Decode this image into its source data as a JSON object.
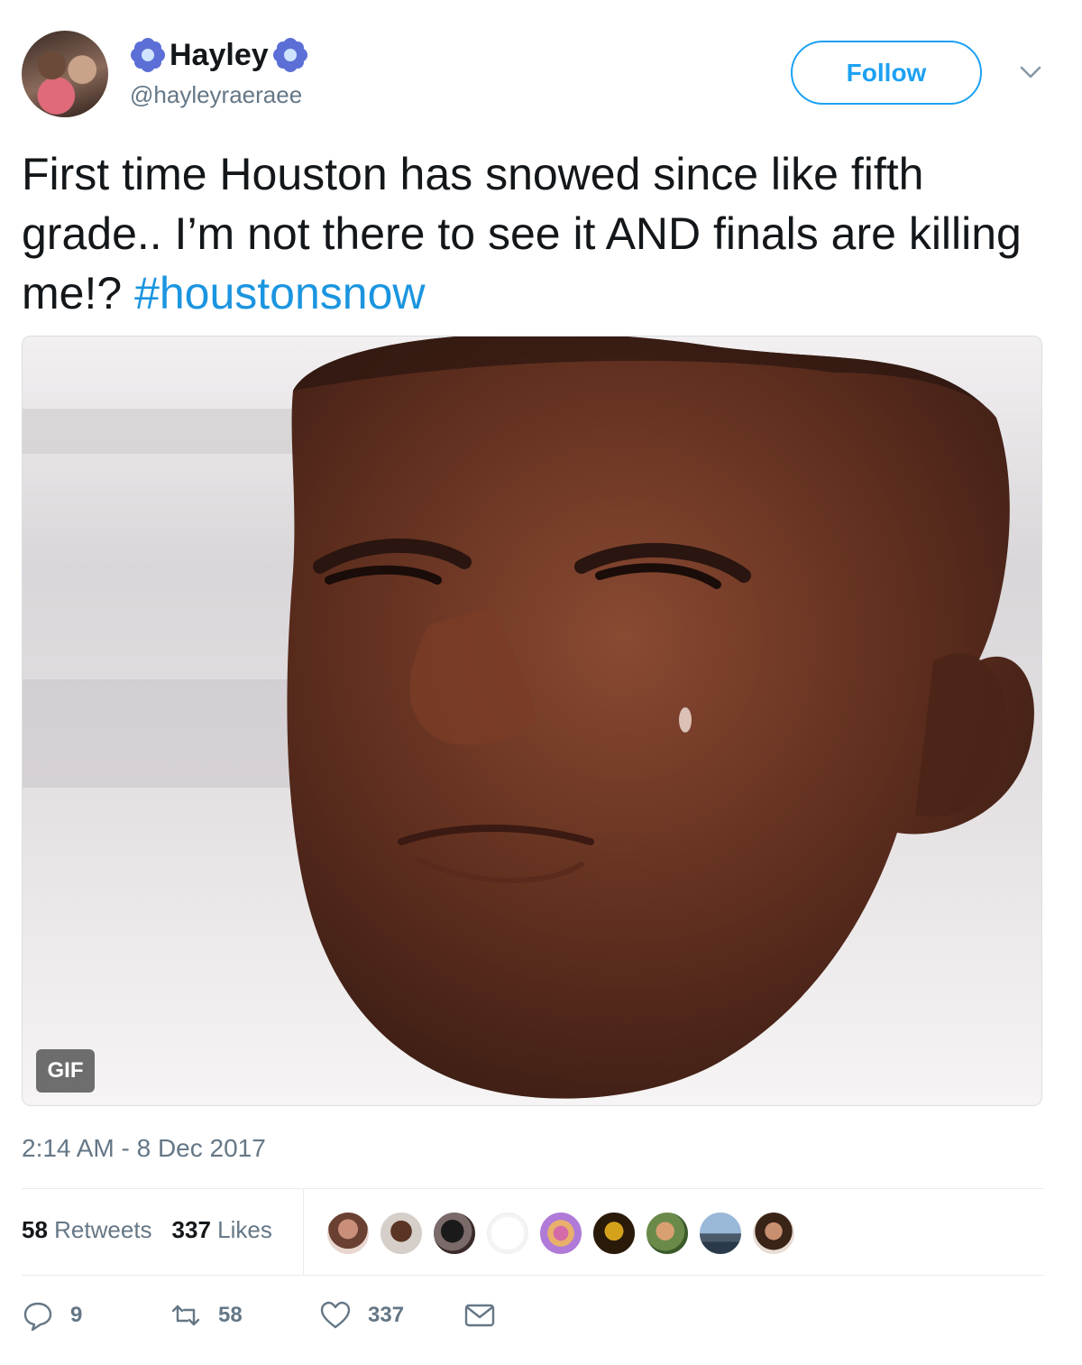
{
  "tweet": {
    "display_name": "Hayley",
    "handle": "@hayleyraeraee",
    "follow_label": "Follow",
    "text": "First time Houston has snowed since like fifth grade.. I’m not there to see it AND finals are killing me!? ",
    "hashtag": "#houstonsnow",
    "media_badge": "GIF",
    "timestamp": "2:14 AM - 8 Dec 2017"
  },
  "stats": {
    "retweets_count": "58",
    "retweets_label": "Retweets",
    "likes_count": "337",
    "likes_label": "Likes"
  },
  "actions": {
    "replies": "9",
    "retweets": "58",
    "likes": "337"
  },
  "icons": [
    "flower-emoji-icon",
    "chevron-down-icon",
    "reply-icon",
    "retweet-icon",
    "heart-icon",
    "envelope-icon"
  ],
  "colors": {
    "accent": "#1da1f2",
    "hashtag": "#1b95e0",
    "secondary_text": "#657786",
    "primary_text": "#14171a",
    "divider": "#e6ecf0"
  }
}
